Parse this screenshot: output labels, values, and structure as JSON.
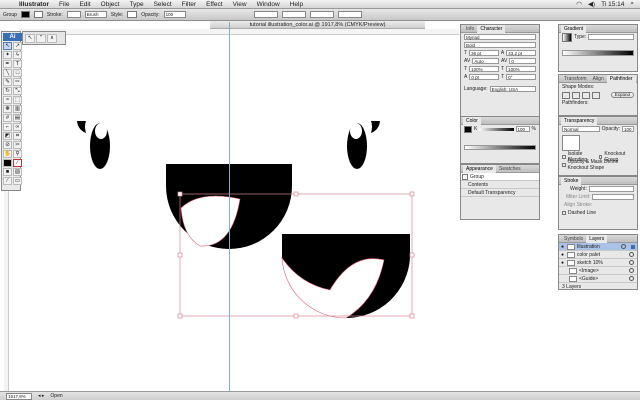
{
  "menubar": {
    "app_name": "Illustrator",
    "items": [
      "File",
      "Edit",
      "Object",
      "Type",
      "Select",
      "Filter",
      "Effect",
      "View",
      "Window",
      "Help"
    ],
    "clock": "Ti 15:14"
  },
  "controlbar": {
    "group_label": "Group",
    "stroke_label": "Stroke:",
    "brush_label": "Brush",
    "style_label": "Style:",
    "opacity_label": "Opacity:",
    "opacity_value": "100"
  },
  "document": {
    "title": "tutorial illustration_color.ai @ 1917,8% (CMYK/Preview)"
  },
  "status": {
    "zoom": "1917,8%",
    "mode": "Open"
  },
  "toolbox": {
    "logo": "Ai"
  },
  "character_panel": {
    "tabs": [
      "Info",
      "Character"
    ],
    "font": "Myriad",
    "style": "Bold",
    "size": "36 pt",
    "leading": "43,2 pt",
    "kerning": "Auto",
    "tracking": "0",
    "hscale": "100%",
    "vscale": "100%",
    "baseline": "0 pt",
    "rotation": "0°",
    "language_label": "Language:",
    "language": "English: USA"
  },
  "color_panel": {
    "title": "Color",
    "k_label": "K",
    "k_value": "100",
    "percent": "%"
  },
  "appearance_panel": {
    "tabs": [
      "Appearance",
      "Swatches"
    ],
    "group": "Group",
    "contents": "Contents",
    "transparency": "Default Transparency"
  },
  "gradient_panel": {
    "title": "Gradient",
    "type_label": "Type:"
  },
  "pathfinder_panel": {
    "tabs": [
      "Transform",
      "Align",
      "Pathfinder"
    ],
    "shape_modes": "Shape Modes:",
    "pathfinders": "Pathfinders:",
    "expand": "Expand"
  },
  "transparency_panel": {
    "title": "Transparency",
    "mode": "Normal",
    "opacity_label": "Opacity:",
    "opacity_value": "100",
    "isolate": "Isolate Blending",
    "knockout": "Knockout Group",
    "opacity_mask": "Opacity & Mask Define Knockout Shape"
  },
  "stroke_panel": {
    "title": "Stroke",
    "weight_label": "Weight:",
    "miter_label": "Miter Limit:",
    "align_label": "Align Stroke:",
    "dashed": "Dashed Line"
  },
  "layers_panel": {
    "tabs": [
      "Symbols",
      "Layers"
    ],
    "layers": [
      {
        "name": "Illustration",
        "selected": true
      },
      {
        "name": "color palet",
        "selected": false
      },
      {
        "name": "sketch 10%",
        "selected": false
      },
      {
        "name": "<Image>",
        "selected": false
      },
      {
        "name": "<Guide>",
        "selected": false
      }
    ],
    "footer": "3 Layers"
  },
  "colors": {
    "selection": "#e0566f",
    "guide": "#7fb2c6",
    "bounding_box": "#d58a95"
  }
}
